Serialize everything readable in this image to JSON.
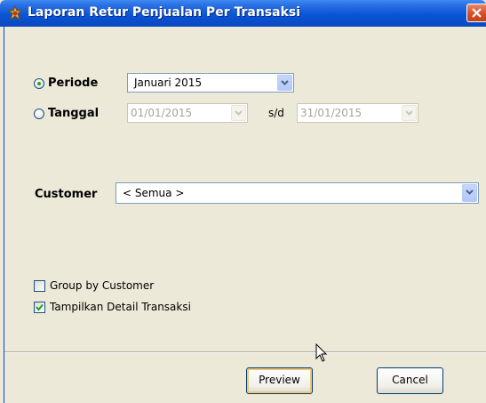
{
  "window": {
    "title": "Laporan Retur Penjualan Per Transaksi"
  },
  "form": {
    "periode": {
      "label": "Periode",
      "selected": true,
      "value": "Januari 2015"
    },
    "tanggal": {
      "label": "Tanggal",
      "selected": false,
      "from": "01/01/2015",
      "separator": "s/d",
      "to": "31/01/2015"
    },
    "customer": {
      "label": "Customer",
      "value": "< Semua >"
    },
    "group_by_customer": {
      "label": "Group by Customer",
      "checked": false
    },
    "tampilkan_detail": {
      "label": "Tampilkan Detail Transaksi",
      "checked": true
    }
  },
  "buttons": {
    "preview": "Preview",
    "cancel": "Cancel"
  },
  "icons": {
    "app": "report-app-icon",
    "close": "close-icon",
    "dropdown": "chevron-down-icon",
    "cursor": "mouse-cursor-icon"
  },
  "colors": {
    "titlebar": "#0a55d6",
    "close_button": "#d9502a",
    "dialog_bg": "#ece9d8",
    "radio_dot": "#21a121",
    "check_mark": "#21a121"
  }
}
